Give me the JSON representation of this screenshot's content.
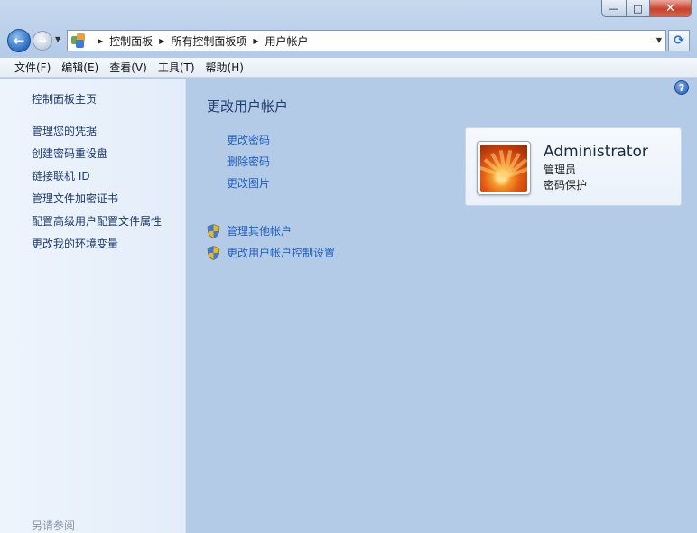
{
  "window": {
    "minimize_glyph": "—",
    "maximize_glyph": "□",
    "close_glyph": "✕"
  },
  "navbar": {
    "back_glyph": "←",
    "forward_glyph": "→",
    "breadcrumbs": [
      "控制面板",
      "所有控制面板项",
      "用户帐户"
    ],
    "refresh_glyph": "⟳"
  },
  "menu": [
    "文件(F)",
    "编辑(E)",
    "查看(V)",
    "工具(T)",
    "帮助(H)"
  ],
  "left": {
    "home": "控制面板主页",
    "links": [
      "管理您的凭据",
      "创建密码重设盘",
      "链接联机 ID",
      "管理文件加密证书",
      "配置高级用户配置文件属性",
      "更改我的环境变量"
    ],
    "see_also": "另请参阅"
  },
  "main": {
    "title": "更改用户帐户",
    "links": [
      "更改密码",
      "删除密码",
      "更改图片"
    ],
    "shield_links": [
      "管理其他帐户",
      "更改用户帐户控制设置"
    ]
  },
  "account": {
    "name": "Administrator",
    "type": "管理员",
    "password_status": "密码保护"
  },
  "help_glyph": "?",
  "colors": {
    "link": "#1f5fbd",
    "title": "#1e3c6e",
    "left_pane": "#e6eff9"
  }
}
